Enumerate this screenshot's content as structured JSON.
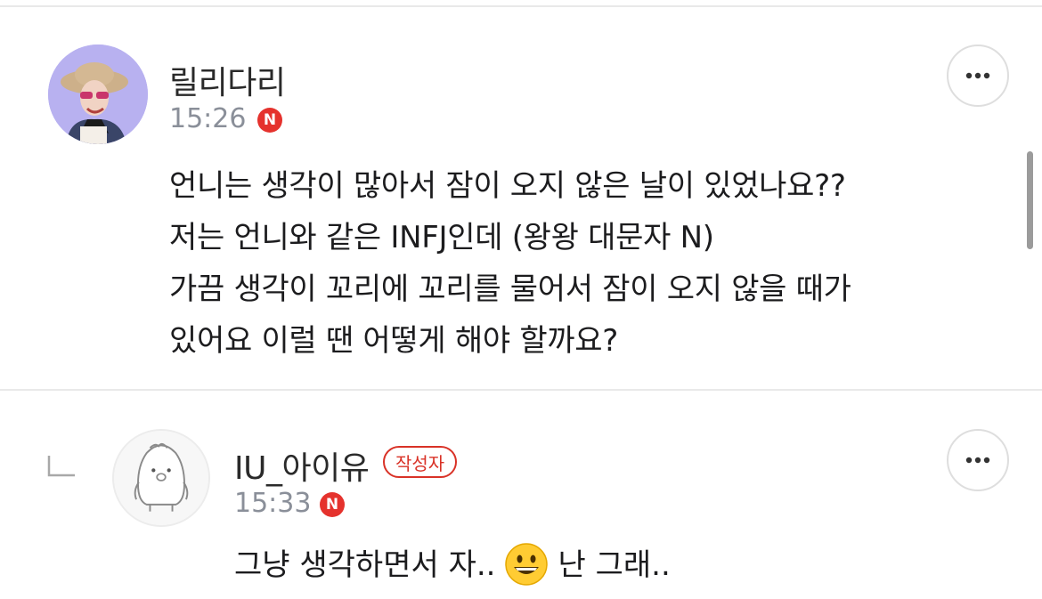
{
  "comment": {
    "username": "릴리다리",
    "time": "15:26",
    "badge_letter": "N",
    "lines": [
      "언니는 생각이 많아서 잠이 오지 않은 날이 있었나요??",
      "저는 언니와 같은 INFJ인데 (왕왕 대문자 N)",
      "가끔 생각이 꼬리에 꼬리를 물어서 잠이 오지 않을 때가",
      "있어요 이럴 땐 어떻게 해야 할까요?"
    ]
  },
  "reply": {
    "username": "IU_아이유",
    "author_badge": "작성자",
    "time": "15:33",
    "badge_letter": "N",
    "text_before": "그냥 생각하면서 자..",
    "emoji_icon": "grinning-face",
    "text_after": "난 그래.."
  },
  "colors": {
    "accent_red": "#e5322d",
    "badge_red": "#d93227",
    "meta_gray": "#8a8f99",
    "divider": "#e9e9e9"
  },
  "icons": {
    "more": "more-horizontal",
    "reply": "reply-corner"
  }
}
